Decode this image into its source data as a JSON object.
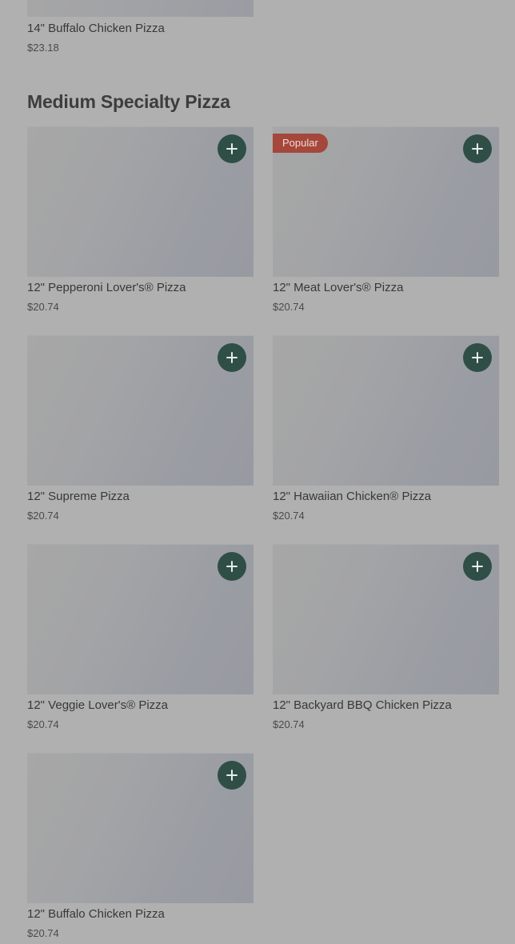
{
  "previous_item": {
    "name": "14\" Buffalo Chicken Pizza",
    "price": "$23.18"
  },
  "section": {
    "title": "Medium Specialty Pizza"
  },
  "add_icon": "plus-icon",
  "colors": {
    "add_button": "#2f4f46",
    "badge": "#a5473a",
    "overlay": "#b0b0b0"
  },
  "items": [
    {
      "name": "12\" Pepperoni Lover's® Pizza",
      "price": "$20.74",
      "badge": ""
    },
    {
      "name": "12\" Meat Lover's® Pizza",
      "price": "$20.74",
      "badge": "Popular"
    },
    {
      "name": "12\" Supreme Pizza",
      "price": "$20.74",
      "badge": ""
    },
    {
      "name": "12\" Hawaiian Chicken® Pizza",
      "price": "$20.74",
      "badge": ""
    },
    {
      "name": "12\" Veggie Lover's® Pizza",
      "price": "$20.74",
      "badge": ""
    },
    {
      "name": "12\" Backyard BBQ Chicken Pizza",
      "price": "$20.74",
      "badge": ""
    },
    {
      "name": "12\" Buffalo Chicken Pizza",
      "price": "$20.74",
      "badge": ""
    }
  ]
}
